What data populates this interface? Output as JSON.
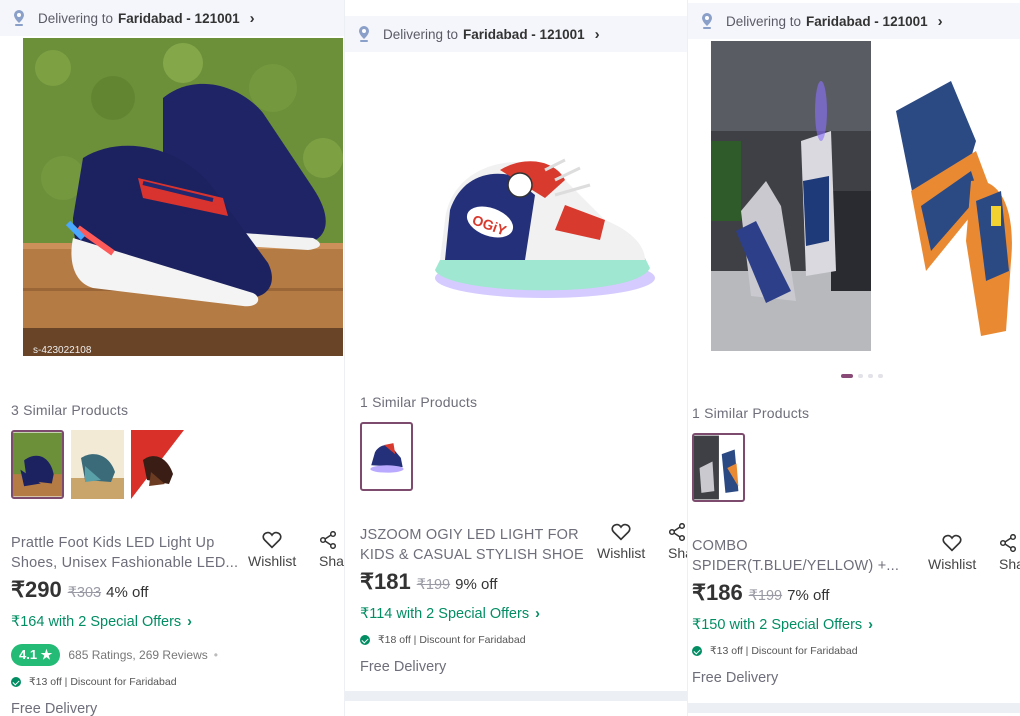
{
  "colors": {
    "accent": "#038d63",
    "rating_badge": "#23bb75",
    "selected_border": "#7d4b6e"
  },
  "panels": [
    {
      "delivery": {
        "label": "Delivering to",
        "location": "Faridabad - 121001"
      },
      "image_code": "s-423022108",
      "similar_title": "3 Similar Products",
      "name_line1": "Prattle Foot Kids LED Light Up",
      "name_line2": "Shoes, Unisex Fashionable LED...",
      "wishlist": "Wishlist",
      "share": "Shar",
      "price": "₹290",
      "mrp": "₹303",
      "off": "4% off",
      "offers": "₹164 with 2 Special Offers",
      "rating": "4.1 ★",
      "ratings_text": "685 Ratings, 269 Reviews",
      "discount": "₹13 off | Discount for Faridabad",
      "delivery_text": "Free Delivery"
    },
    {
      "delivery": {
        "label": "Delivering to",
        "location": "Faridabad - 121001"
      },
      "similar_title": "1 Similar Products",
      "name_line1": "JSZOOM OGIY LED LIGHT FOR",
      "name_line2": "KIDS & CASUAL STYLISH SHOE",
      "wishlist": "Wishlist",
      "share": "Sha",
      "price": "₹181",
      "mrp": "₹199",
      "off": "9% off",
      "offers": "₹114 with 2 Special Offers",
      "discount": "₹18 off | Discount for Faridabad",
      "delivery_text": "Free Delivery",
      "brand_text": "OGiY"
    },
    {
      "delivery": {
        "label": "Delivering to",
        "location": "Faridabad - 121001"
      },
      "similar_title": "1 Similar Products",
      "name_line1": "COMBO",
      "name_line2": "SPIDER(T.BLUE/YELLOW) +...",
      "wishlist": "Wishlist",
      "share": "Sha",
      "price": "₹186",
      "mrp": "₹199",
      "off": "7% off",
      "offers": "₹150 with 2 Special Offers",
      "discount": "₹13 off | Discount for Faridabad",
      "delivery_text": "Free Delivery"
    }
  ],
  "icons": {
    "location": "location-pin-icon",
    "chevron": "›",
    "heart": "heart-icon",
    "share": "share-icon"
  }
}
